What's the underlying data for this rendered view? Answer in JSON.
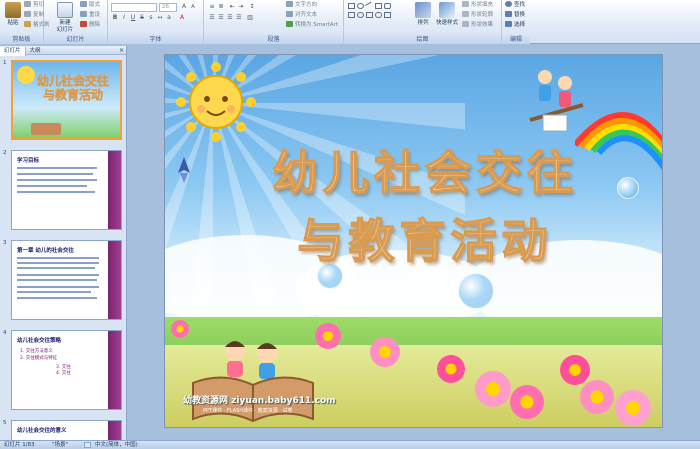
{
  "ribbon": {
    "clipboard": {
      "paste": "粘贴",
      "cut": "剪切",
      "copy": "复制",
      "format_painter": "格式刷",
      "label": "剪贴板"
    },
    "slides": {
      "new_slide": "新建\n幻灯片",
      "layout": "版式",
      "reset": "重设",
      "delete": "删除",
      "label": "幻灯片"
    },
    "font": {
      "font_name": "",
      "font_size": "26",
      "label": "字体"
    },
    "paragraph": {
      "text_direction": "文字方向",
      "align_text": "对齐文本",
      "smartart": "转换为 SmartArt",
      "label": "段落"
    },
    "drawing": {
      "arrange": "排列",
      "quick_styles": "快速样式",
      "shape_fill": "形状填充",
      "shape_outline": "形状轮廓",
      "shape_effects": "形状效果",
      "label": "绘图"
    },
    "editing": {
      "find": "查找",
      "replace": "替换",
      "select": "选择",
      "label": "编辑"
    }
  },
  "panel": {
    "tabs": [
      "幻灯片",
      "大纲"
    ],
    "close": "×",
    "thumbnails": [
      {
        "num": "1",
        "title": "幼儿社会交往\n与教育活动"
      },
      {
        "num": "2",
        "title": "学习目标"
      },
      {
        "num": "3",
        "title": "第一章 幼儿的社会交往"
      },
      {
        "num": "4",
        "title": "幼儿社会交往策略",
        "items": [
          "1. 交往方法意义",
          "2. 交往模式与特征",
          "3. 交往",
          "4. 交往"
        ]
      },
      {
        "num": "5",
        "title": "幼儿社会交往的意义"
      }
    ]
  },
  "slide": {
    "title_line1": "幼儿社会交往",
    "title_line2": "与教育活动",
    "watermark": "幼教资源网 ziyuan.baby611.com",
    "watermark_sub": "PPT课件 · FLASH课件 · 教案资源 · 试卷"
  },
  "status": {
    "slide_info": "幻灯片 1/83",
    "theme": "\"场景\"",
    "language": "中文(简体，中国)"
  },
  "colors": {
    "title_fill": "#f4d7a8",
    "title_stroke": "#d99a52",
    "selected_thumb": "#f2a13a",
    "thumb_stripe": "#7a2370"
  }
}
